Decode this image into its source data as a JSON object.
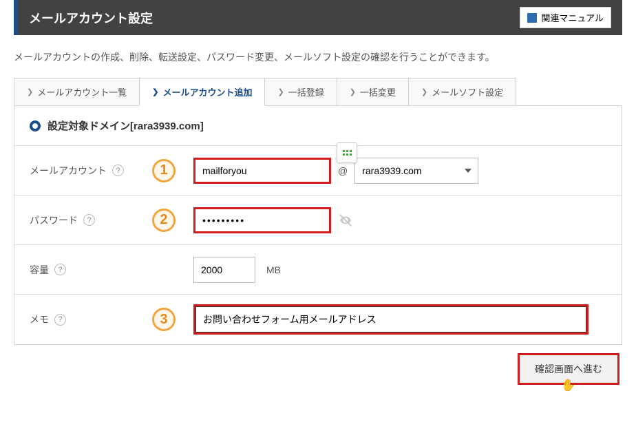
{
  "header": {
    "title": "メールアカウント設定",
    "manual_label": "関連マニュアル"
  },
  "description": "メールアカウントの作成、削除、転送設定、パスワード変更、メールソフト設定の確認を行うことができます。",
  "tabs": {
    "list": "メールアカウント一覧",
    "add": "メールアカウント追加",
    "bulk_register": "一括登録",
    "bulk_update": "一括変更",
    "mailsoft": "メールソフト設定"
  },
  "domain_row": {
    "label": "設定対象ドメイン",
    "value": "[rara3939.com]"
  },
  "form": {
    "account_label": "メールアカウント",
    "account_value": "mailforyou",
    "at_symbol": "@",
    "domain_selected": "rara3939.com",
    "password_label": "パスワード",
    "password_value": "•••••••••",
    "capacity_label": "容量",
    "capacity_value": "2000",
    "capacity_unit": "MB",
    "memo_label": "メモ",
    "memo_value": "お問い合わせフォーム用メールアドレス"
  },
  "markers": {
    "m1": "1",
    "m2": "2",
    "m3": "3"
  },
  "buttons": {
    "submit": "確認画面へ進む"
  }
}
